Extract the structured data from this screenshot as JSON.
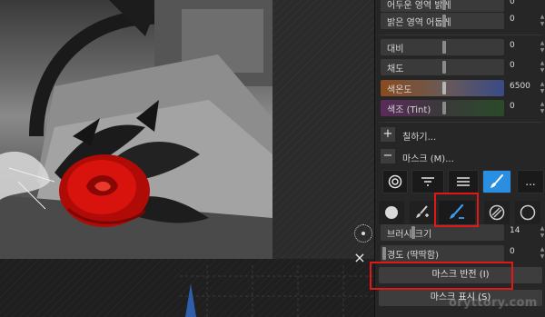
{
  "panel": {
    "sliders_top": [
      {
        "label": "어두운 영역 밝게",
        "value": "0"
      },
      {
        "label": "밝은 영역 어둡게",
        "value": "0"
      }
    ],
    "sliders_color": [
      {
        "label": "대비",
        "value": "0"
      },
      {
        "label": "채도",
        "value": "0"
      },
      {
        "label": "색온도",
        "value": "6500"
      },
      {
        "label": "색조 (Tint)",
        "value": "0"
      }
    ],
    "sections": {
      "fill_label": "칠하기...",
      "fill_icon": "+",
      "mask_label": "마스크 (M)...",
      "mask_icon": "−"
    },
    "mask_tools": {
      "tabs": [
        "target-circle-icon",
        "filter-icon",
        "lines-icon",
        "brush-icon",
        "more-icon"
      ],
      "more_label": "...",
      "brushes": [
        "circle-brush-icon",
        "add-brush-icon",
        "erase-brush-icon",
        "hatched-circle-icon",
        "empty-circle-icon"
      ]
    },
    "brush_sliders": [
      {
        "label": "브러시 크기",
        "value": "14"
      },
      {
        "label": "경도 (딱딱함)",
        "value": "0"
      }
    ],
    "buttons": {
      "invert_mask": "마스크 반전 (I)",
      "show_mask": "마스크 표시 (S)"
    }
  },
  "canvas": {
    "close_icon": "×"
  },
  "watermark": "oryttory.com",
  "colors": {
    "accent": "#2a8fe0",
    "highlight": "#e01818",
    "rose": "#d8120d"
  }
}
